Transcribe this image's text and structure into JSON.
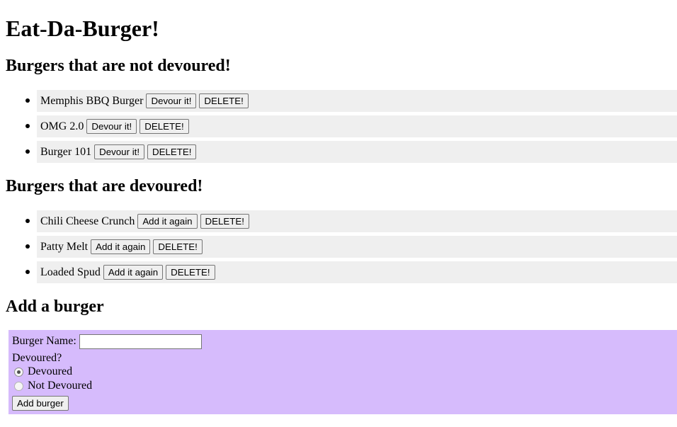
{
  "title": "Eat-Da-Burger!",
  "not_devoured": {
    "heading": "Burgers that are not devoured!",
    "items": [
      {
        "name": "Memphis BBQ Burger",
        "action": "Devour it!",
        "delete": "DELETE!"
      },
      {
        "name": "OMG 2.0",
        "action": "Devour it!",
        "delete": "DELETE!"
      },
      {
        "name": "Burger 101",
        "action": "Devour it!",
        "delete": "DELETE!"
      }
    ]
  },
  "devoured": {
    "heading": "Burgers that are devoured!",
    "items": [
      {
        "name": "Chili Cheese Crunch",
        "action": "Add it again",
        "delete": "DELETE!"
      },
      {
        "name": "Patty Melt",
        "action": "Add it again",
        "delete": "DELETE!"
      },
      {
        "name": "Loaded Spud",
        "action": "Add it again",
        "delete": "DELETE!"
      }
    ]
  },
  "add_form": {
    "heading": "Add a burger",
    "name_label": "Burger Name:",
    "name_value": "",
    "devoured_label": "Devoured?",
    "option_devoured": "Devoured",
    "option_not_devoured": "Not Devoured",
    "selected": "Devoured",
    "submit_label": "Add burger"
  },
  "colors": {
    "form_background": "#d6bbfc",
    "list_item_background": "#efefef"
  }
}
